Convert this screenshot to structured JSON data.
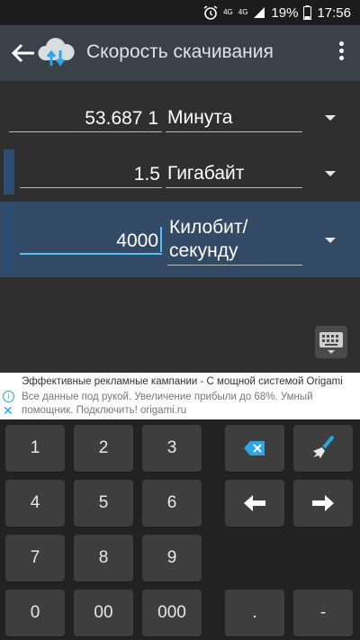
{
  "status_bar": {
    "network_1": "4G",
    "network_2": "4G",
    "battery": "19%",
    "time": "17:56"
  },
  "app_bar": {
    "title": "Скорость скачивания"
  },
  "rows": [
    {
      "value": "53.687 1",
      "unit": "Минута"
    },
    {
      "value": "1.5",
      "unit": "Гигабайт"
    },
    {
      "value": "4000",
      "unit_line1": "Килобит/",
      "unit_line2": "секунду"
    }
  ],
  "ad": {
    "title": "Эффективные рекламные кампании - С мощной системой Origami",
    "body": "Все данные под рукой. Увеличение прибыли до 68%. Умный помощник. Подключить! origami.ru",
    "info_glyph": "i",
    "close_glyph": "✕"
  },
  "keypad": {
    "k1": "1",
    "k2": "2",
    "k3": "3",
    "k4": "4",
    "k5": "5",
    "k6": "6",
    "k7": "7",
    "k8": "8",
    "k9": "9",
    "k0": "0",
    "k00": "00",
    "k000": "000",
    "dot": ".",
    "minus": "-"
  },
  "icons": [
    "alarm-icon",
    "signal-icon",
    "battery-icon",
    "back-arrow-icon",
    "cloud-logo-icon",
    "overflow-menu-icon",
    "dropdown-icon",
    "keyboard-icon",
    "backspace-icon",
    "clear-brush-icon",
    "cursor-left-icon",
    "cursor-right-icon",
    "info-icon",
    "close-icon"
  ],
  "colors": {
    "appbar": "#3a4148",
    "selected_row": "#324a66",
    "accent": "#27a4e2"
  }
}
